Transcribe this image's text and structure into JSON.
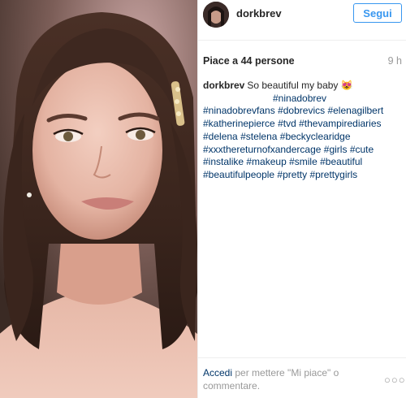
{
  "post": {
    "image_alt": "Portrait of a woman with wavy brown hair and a hair clip"
  },
  "header": {
    "username": "dorkbrev",
    "follow_label": "Segui"
  },
  "stats": {
    "likes": "Piace a 44 persone",
    "time": "9 h"
  },
  "caption": {
    "username": "dorkbrev",
    "text": "So beautiful my baby",
    "emoji": "😻",
    "hashtags": [
      "#ninadobrev",
      "#ninadobrevfans",
      "#dobrevics",
      "#elenagilbert",
      "#katherinepierce",
      "#tvd",
      "#thevampirediaries",
      "#delena",
      "#stelena",
      "#beckyclearidge",
      "#xxxthereturnofxandercage",
      "#girls",
      "#cute",
      "#instalike",
      "#makeup",
      "#smile",
      "#beautiful",
      "#beautifulpeople",
      "#pretty",
      "#prettygirls"
    ]
  },
  "footer": {
    "login_link": "Accedi",
    "login_text": " per mettere \"Mi piace\" o commentare.",
    "more": "○○○"
  }
}
